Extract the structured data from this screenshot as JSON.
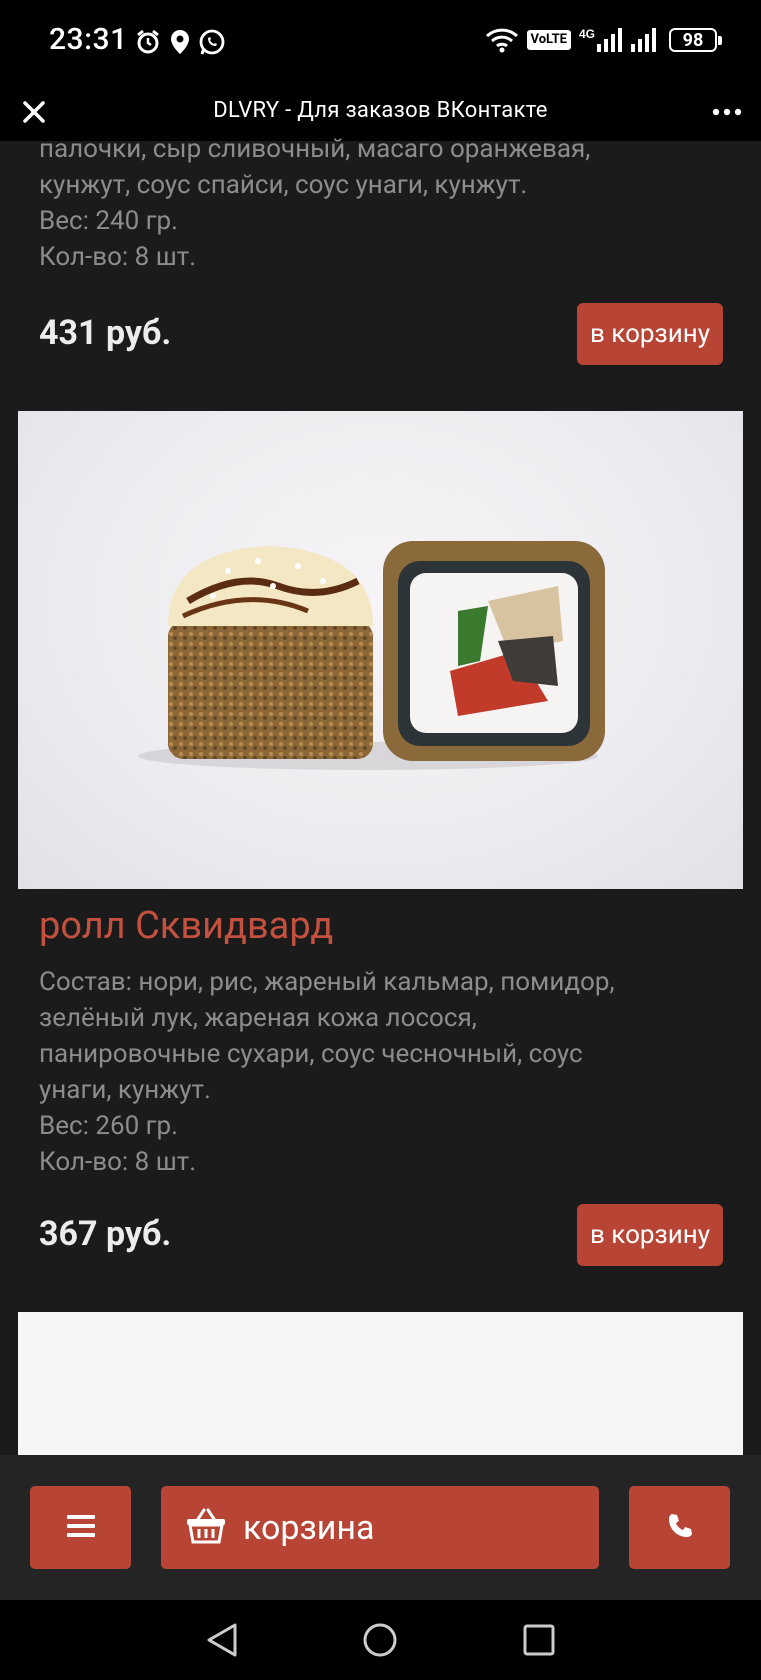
{
  "status_bar": {
    "time": "23:31",
    "left_icons": [
      "alarm-icon",
      "location-icon",
      "whatsapp-icon"
    ],
    "right_icons": [
      "wifi-icon",
      "volte-icon",
      "4g-signal-icon",
      "signal-icon",
      "battery-icon"
    ],
    "volte_label": "VoLTE",
    "network_label": "4G",
    "battery_level": "98"
  },
  "app_bar": {
    "title": "DLVRY - Для заказов ВКонтакте"
  },
  "previous_item": {
    "description_lines": [
      "палочки, сыр сливочный, масаго оранжевая,",
      "кунжут, соус спайси, соус унаги, кунжут.",
      "Вес: 240 гр.",
      "Кол-во: 8 шт."
    ],
    "price": "431 руб.",
    "add_to_cart_label": "в корзину"
  },
  "product": {
    "title": "ролл Сквидвард",
    "description_lines": [
      "Состав: нори, рис, жареный кальмар, помидор,",
      "зелёный лук, жареная кожа лосося,",
      "панировочные сухари, соус чесночный, соус",
      "унаги, кунжут.",
      "Вес: 260 гр.",
      "Кол-во: 8 шт."
    ],
    "price": "367 руб.",
    "add_to_cart_label": "в корзину"
  },
  "bottom_bar": {
    "menu_icon": "hamburger-menu-icon",
    "cart_label": "корзина",
    "cart_icon": "basket-icon",
    "phone_icon": "phone-icon"
  },
  "colors": {
    "background": "#1b1b1b",
    "accent": "#b74434",
    "title_accent": "#c4513f",
    "text_muted": "#8c8c8c"
  }
}
